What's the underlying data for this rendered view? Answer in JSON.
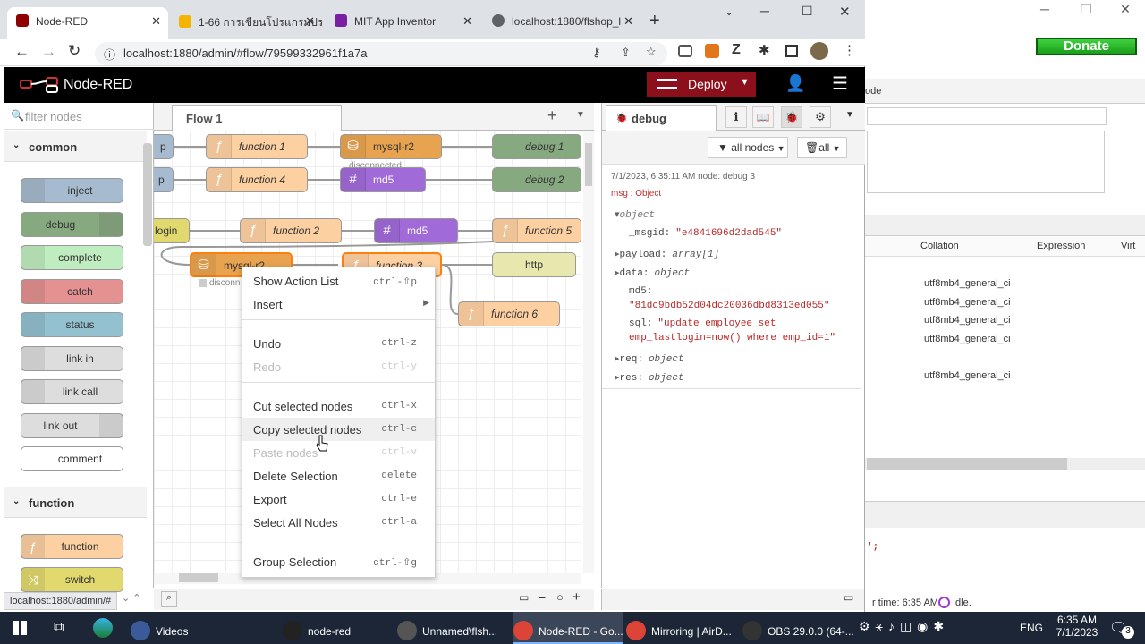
{
  "bgwin": {
    "donate": "Donate",
    "ode": "ode",
    "headers": [
      "Collation",
      "Expression",
      "Virt"
    ],
    "collations": [
      "utf8mb4_general_ci",
      "utf8mb4_general_ci",
      "utf8mb4_general_ci",
      "utf8mb4_general_ci",
      "utf8mb4_general_ci"
    ],
    "code_tail": "';",
    "status_time": "r time: 6:35 AM",
    "status_idle": "Idle."
  },
  "browser": {
    "tabs": [
      {
        "label": "Node-RED",
        "color": "#8f0000"
      },
      {
        "label": "1-66 การเขียนโปรแกรมประ",
        "color": "#f4b400"
      },
      {
        "label": "MIT App Inventor",
        "color": "#7b1fa2"
      },
      {
        "label": "localhost:1880/flshop_l",
        "color": "#5f6368"
      }
    ],
    "url": "localhost:1880/admin/#flow/79599332961f1a7a",
    "status_url": "localhost:1880/admin/#"
  },
  "nr": {
    "title": "Node-RED",
    "deploy": "Deploy",
    "palette": {
      "filter": "filter nodes",
      "common": "common",
      "common_nodes": [
        {
          "label": "inject",
          "color": "#a6bbcf"
        },
        {
          "label": "debug",
          "color": "#87a980"
        },
        {
          "label": "complete",
          "color": "#c0edc0"
        },
        {
          "label": "catch",
          "color": "#e49191"
        },
        {
          "label": "status",
          "color": "#94c1d0"
        },
        {
          "label": "link in",
          "color": "#dddddd"
        },
        {
          "label": "link call",
          "color": "#dddddd"
        },
        {
          "label": "link out",
          "color": "#dddddd"
        },
        {
          "label": "comment",
          "color": "#ffffff"
        }
      ],
      "function": "function",
      "function_nodes": [
        {
          "label": "function",
          "color": "#fdd0a2"
        },
        {
          "label": "switch",
          "color": "#e2d96e"
        }
      ]
    },
    "flow_tab": "Flow 1",
    "flow_nodes": {
      "n0a": "p",
      "n0b": "p",
      "f1": "function 1",
      "f4": "function 4",
      "f2": "function 2",
      "f5": "function 5",
      "f6": "function 6",
      "mysql": "mysql-r2",
      "mysql2": "mysql-r2",
      "md5a": "md5",
      "md5b": "md5",
      "d1": "debug 1",
      "d2": "debug 2",
      "http": "http",
      "login": "login",
      "disc1": "disconnected",
      "disc2": "disconn",
      "f3": "function 3"
    },
    "menu": [
      {
        "label": "Show Action List",
        "sc": "ctrl-⇧p",
        "dis": false
      },
      {
        "label": "Insert",
        "sc": "",
        "dis": false
      },
      {
        "label": "Undo",
        "sc": "ctrl-z",
        "dis": false
      },
      {
        "label": "Redo",
        "sc": "ctrl-y",
        "dis": true
      },
      {
        "label": "Cut selected nodes",
        "sc": "ctrl-x",
        "dis": false
      },
      {
        "label": "Copy selected nodes",
        "sc": "ctrl-c",
        "dis": false
      },
      {
        "label": "Paste nodes",
        "sc": "ctrl-v",
        "dis": true
      },
      {
        "label": "Delete Selection",
        "sc": "delete",
        "dis": false
      },
      {
        "label": "Export",
        "sc": "ctrl-e",
        "dis": false
      },
      {
        "label": "Select All Nodes",
        "sc": "ctrl-a",
        "dis": false
      },
      {
        "label": "Group Selection",
        "sc": "ctrl-⇧g",
        "dis": false
      }
    ],
    "debug": {
      "tab": "debug",
      "filter": "all nodes",
      "clear": "all",
      "meta": "7/1/2023, 6:35:11 AM   node: debug 3",
      "msg": "msg : Object",
      "lines": [
        {
          "k": "object",
          "v": ""
        },
        {
          "k": "_msgid:",
          "v": "\"e4841696d2dad545\""
        },
        {
          "k": "payload:",
          "v": "array[1]"
        },
        {
          "k": "data:",
          "v": "object"
        },
        {
          "k": "md5:",
          "v": ""
        },
        {
          "k": "",
          "v": "\"81dc9bdb52d04dc20036dbd8313ed055\""
        },
        {
          "k": "sql:",
          "v": "\"update employee set"
        },
        {
          "k": "",
          "v": "emp_lastlogin=now() where emp_id=1\""
        },
        {
          "k": "req:",
          "v": "object"
        },
        {
          "k": "res:",
          "v": "object"
        }
      ]
    }
  },
  "taskbar": {
    "items": [
      {
        "label": "Videos",
        "color": "#3a5a9a"
      },
      {
        "label": "node-red",
        "color": "#222"
      },
      {
        "label": "Unnamed\\flsh...",
        "color": "#555"
      },
      {
        "label": "Node-RED - Go...",
        "color": "#db4437"
      },
      {
        "label": "Mirroring | AirD...",
        "color": "#db4437"
      },
      {
        "label": "OBS 29.0.0 (64-...",
        "color": "#333"
      }
    ],
    "lang": "ENG",
    "time": "6:35 AM",
    "date": "7/1/2023",
    "notif": "3"
  }
}
